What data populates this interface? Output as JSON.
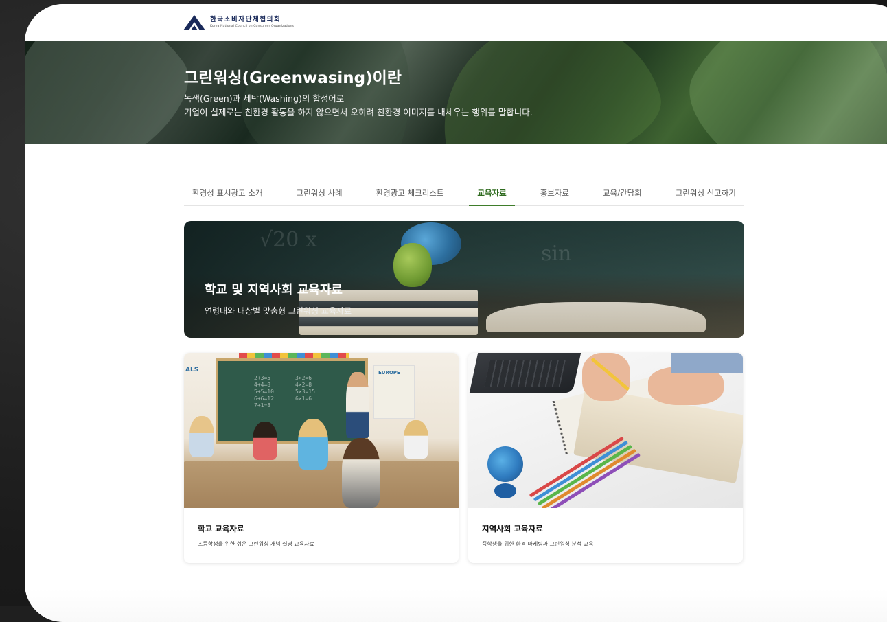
{
  "brand": {
    "name_ko": "한국소비자단체협의회",
    "name_en": "Korea National Council on Consumer Organizations",
    "logo_icon": "mountain-a-icon"
  },
  "hero": {
    "title": "그린워싱(Greenwasing)이란",
    "desc_line1": "녹색(Green)과 세탁(Washing)의 합성어로",
    "desc_line2": "기업이 실제로는 친환경 활동을 하지 않으면서 오히려 친환경 이미지를 내세우는 행위를 말합니다."
  },
  "tabs": [
    {
      "label": "환경성 표시광고 소개"
    },
    {
      "label": "그린워싱 사례"
    },
    {
      "label": "환경광고 체크리스트"
    },
    {
      "label": "교육자료"
    },
    {
      "label": "홍보자료"
    },
    {
      "label": "교육/간담회"
    },
    {
      "label": "그린워싱 신고하기"
    }
  ],
  "active_tab": "교육자료",
  "feature": {
    "title": "학교 및 지역사회 교육자료",
    "subtitle": "연령대와 대상별 맞춤형 그린워싱 교육자료",
    "chalk_1": "√20 x",
    "chalk_2": "sin"
  },
  "cards": [
    {
      "title": "학교 교육자료",
      "desc": "초등학생을 위한 쉬운 그린워싱 개념 설명 교육자료",
      "image_label_1": "ALS",
      "image_label_2": "EUROPE"
    },
    {
      "title": "지역사회 교육자료",
      "desc": "중학생을 위한 환경 마케팅과 그린워싱 분석 교육"
    }
  ],
  "colors": {
    "accent": "#3f7d2b",
    "brand_navy": "#1a2a5a",
    "frame_bg": "#1f1f1f"
  }
}
